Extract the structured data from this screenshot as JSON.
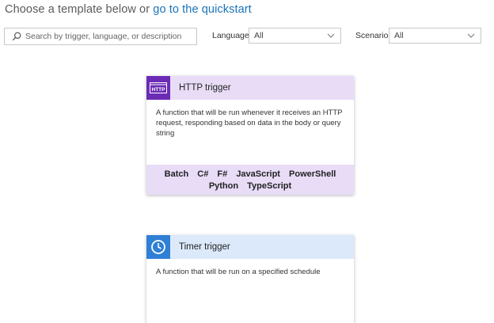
{
  "header": {
    "prefix": "Choose a template below or",
    "link": "go to the quickstart"
  },
  "search": {
    "placeholder": "Search by trigger, language, or description",
    "value": ""
  },
  "filters": {
    "language": {
      "label": "Language:",
      "selected": "All"
    },
    "scenario": {
      "label": "Scenario:",
      "selected": "All"
    }
  },
  "templates": [
    {
      "title": "HTTP trigger",
      "icon": "http-icon",
      "icon_text": "HTTP",
      "description": "A function that will be run whenever it receives an HTTP request, responding based on data in the body or query string",
      "languages": [
        "Batch",
        "C#",
        "F#",
        "JavaScript",
        "PowerShell",
        "Python",
        "TypeScript"
      ],
      "accent": "#6b2bb5",
      "tint": "#e8dcf7"
    },
    {
      "title": "Timer trigger",
      "icon": "clock-icon",
      "description": "A function that will be run on a specified schedule",
      "accent": "#2f7fd6",
      "tint": "#dce9fb"
    }
  ]
}
